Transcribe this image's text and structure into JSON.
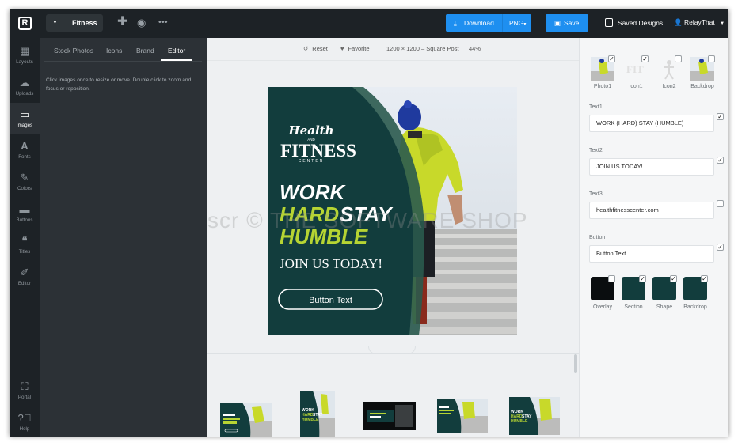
{
  "topbar": {
    "logo": "R",
    "project_name": "Fitness",
    "download_label": "Download",
    "format": "PNG",
    "save_label": "Save",
    "saved_designs_label": "Saved Designs",
    "user_name": "RelayThat"
  },
  "rail": {
    "items": [
      {
        "label": "Layouts",
        "icon": "layouts-icon"
      },
      {
        "label": "Uploads",
        "icon": "upload-cloud-icon"
      },
      {
        "label": "Images",
        "icon": "image-icon"
      },
      {
        "label": "Fonts",
        "icon": "font-icon"
      },
      {
        "label": "Colors",
        "icon": "brush-icon"
      },
      {
        "label": "Buttons",
        "icon": "button-icon"
      },
      {
        "label": "Titles",
        "icon": "quote-icon"
      },
      {
        "label": "Editor",
        "icon": "edit-icon"
      }
    ],
    "bottom": [
      {
        "label": "Portal",
        "icon": "portal-icon"
      },
      {
        "label": "Help",
        "icon": "help-icon"
      }
    ]
  },
  "panel": {
    "tabs": [
      "Stock Photos",
      "Icons",
      "Brand",
      "Editor"
    ],
    "active_tab": "Editor",
    "hint": "Click images once to resize or move. Double click to zoom and focus or reposition."
  },
  "toolbar": {
    "reset": "Reset",
    "favorite": "Favorite",
    "size": "1200 × 1200 – Square Post",
    "zoom": "44%"
  },
  "design": {
    "logo_line1": "Health",
    "logo_and": "AND",
    "logo_line2": "FITNESS",
    "logo_line3": "CENTER",
    "headline_work": "WORK",
    "headline_hard": "HARD",
    "headline_stay": "STAY",
    "headline_humble": "HUMBLE",
    "subhead": "JOIN US TODAY!",
    "button": "Button Text"
  },
  "thumbnails": {
    "mini_work": "WORK",
    "mini_hard": "HARD",
    "mini_stay": "STAY",
    "mini_humble": "HUMBLE"
  },
  "right": {
    "images": [
      {
        "label": "Photo1",
        "checked": true
      },
      {
        "label": "Icon1",
        "checked": true
      },
      {
        "label": "Icon2",
        "checked": false
      },
      {
        "label": "Backdrop",
        "checked": false
      }
    ],
    "fields": [
      {
        "label": "Text1",
        "value": "WORK (HARD) STAY (HUMBLE)",
        "checked": true
      },
      {
        "label": "Text2",
        "value": "JOIN US TODAY!",
        "checked": true
      },
      {
        "label": "Text3",
        "value": "healthfitnesscenter.com",
        "checked": false
      },
      {
        "label": "Button",
        "value": "Button Text",
        "checked": true
      }
    ],
    "swatches": [
      {
        "label": "Overlay",
        "color": "#0a0d0f",
        "checked": false
      },
      {
        "label": "Section",
        "color": "#123d3d",
        "checked": true
      },
      {
        "label": "Shape",
        "color": "#123d3d",
        "checked": true
      },
      {
        "label": "Backdrop",
        "color": "#123d3d",
        "checked": true
      }
    ]
  },
  "colors": {
    "accent": "#1e8ff0",
    "dark_teal": "#123d3d",
    "lime": "#b6d433",
    "sidebar": "#1d2226"
  },
  "watermark": "scr © THE SOFTWARE SHOP"
}
